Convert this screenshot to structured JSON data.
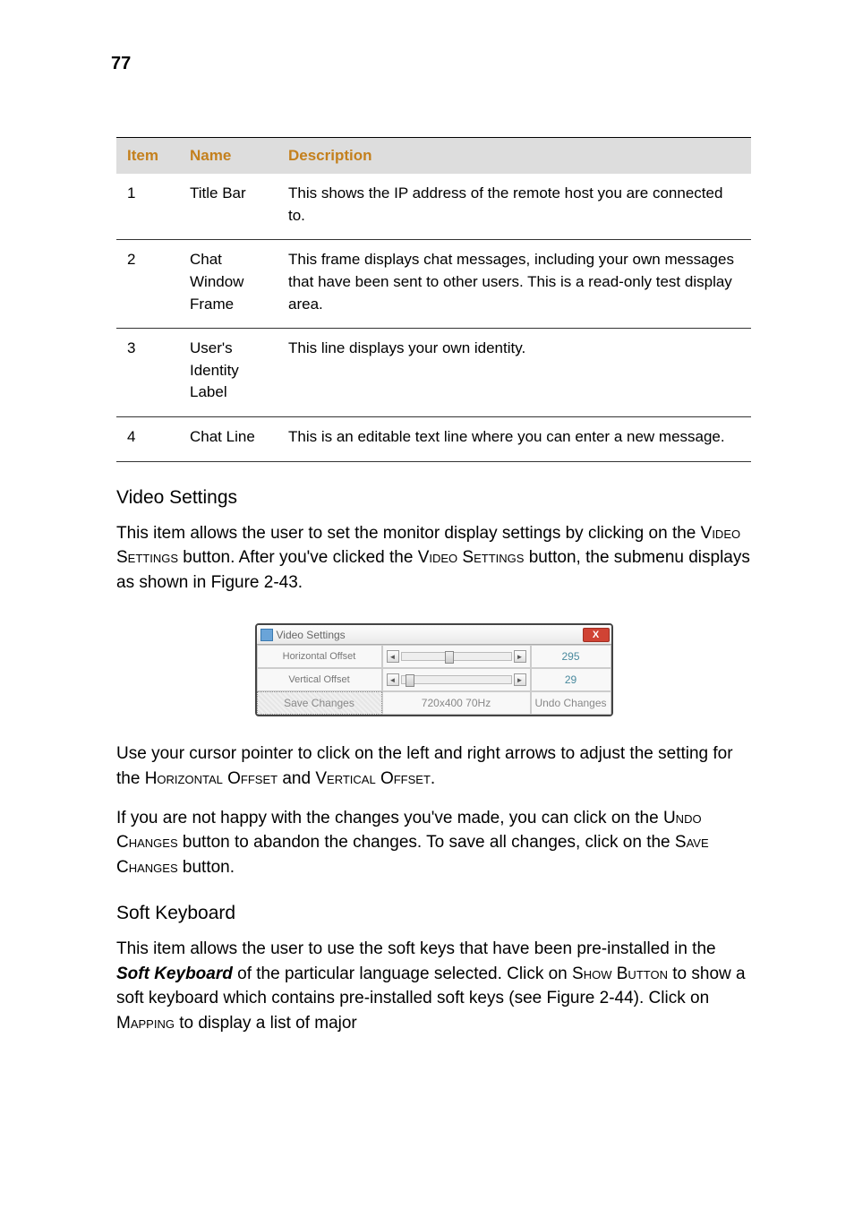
{
  "page_number": "77",
  "table": {
    "headers": {
      "item": "Item",
      "name": "Name",
      "description": "Description"
    },
    "rows": [
      {
        "item": "1",
        "name": "Title Bar",
        "description": "This shows the IP address of the remote host you are connected to."
      },
      {
        "item": "2",
        "name": "Chat Window Frame",
        "description": "This frame displays chat messages, including your own messages that have been sent to other users. This is a read-only test display area."
      },
      {
        "item": "3",
        "name": "User's Identity Label",
        "description": "This line displays your own identity."
      },
      {
        "item": "4",
        "name": "Chat Line",
        "description": "This is an editable text line where you can enter a new message."
      }
    ]
  },
  "section_video": {
    "heading": "Video Settings",
    "para1_a": "This item allows the user to set the monitor display settings by clicking on the ",
    "para1_sc1": "Video Settings",
    "para1_b": " button. After you've clicked the ",
    "para1_sc2": "Video Settings",
    "para1_c": " button, the submenu displays as shown in Figure 2-43."
  },
  "dialog": {
    "title": "Video Settings",
    "close": "X",
    "hlabel": "Horizontal Offset",
    "vlabel": "Vertical Offset",
    "hval": "295",
    "vval": "29",
    "save": "Save Changes",
    "res": "720x400 70Hz",
    "undo": "Undo Changes",
    "arrow_left": "◄",
    "arrow_right": "►"
  },
  "after_dialog": {
    "p1_a": "Use your cursor pointer to click on the left and right arrows to adjust the setting for the ",
    "p1_sc1": "Horizontal Offset",
    "p1_b": " and ",
    "p1_sc2": "Vertical Offset",
    "p1_c": ".",
    "p2_a": "If you are not happy with the changes you've made, you can click on the ",
    "p2_sc1": "Undo Changes",
    "p2_b": " button to abandon the changes. To save all changes, click on the ",
    "p2_sc2": "Save Changes",
    "p2_c": " button."
  },
  "section_soft": {
    "heading": "Soft Keyboard",
    "p_a": "This item allows the user to use the soft keys that have been pre-installed in the ",
    "p_it": "Soft Keyboard",
    "p_b": " of the particular language selected. Click on ",
    "p_sc1": "Show Button",
    "p_c": " to show a soft keyboard which contains pre-installed soft keys (see Figure 2-44). Click on ",
    "p_sc2": "Mapping",
    "p_d": " to display a list of major"
  }
}
